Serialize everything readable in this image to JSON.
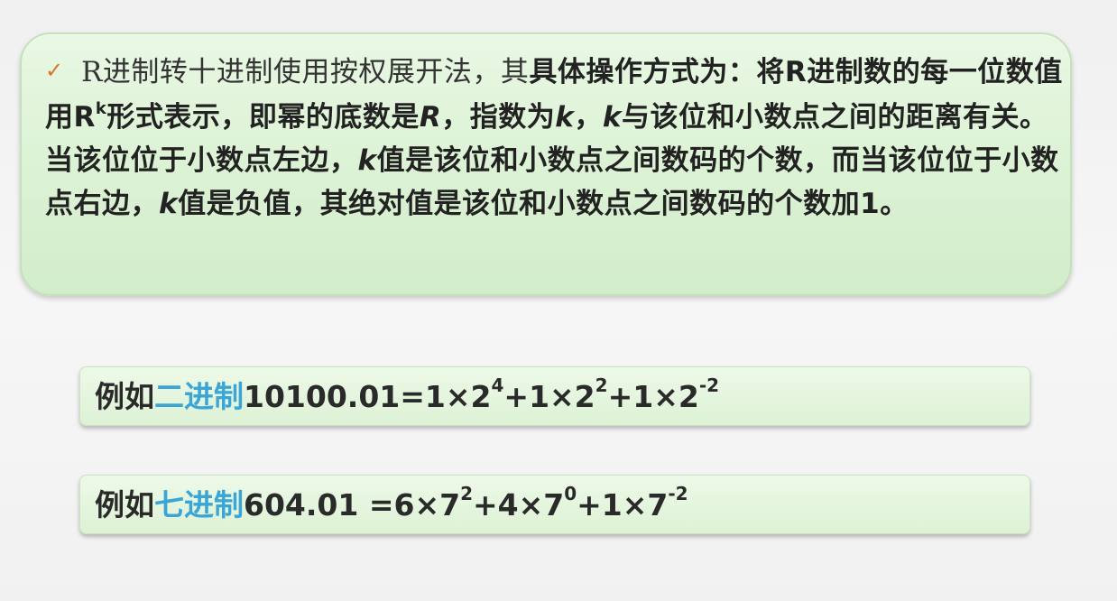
{
  "main": {
    "check_icon": "✓",
    "lead_normal": "R进制转十进制使用按权展开法，其",
    "seg1": "具体操作方式为：将R进制数的每一位数值用R",
    "sup_k": "k",
    "seg2": "形式表示，即幂的底数是",
    "var_R": "R",
    "seg3": "，指数为",
    "var_k1": "k",
    "seg4": "，",
    "var_k2": "k",
    "seg5": "与该位和小数点之间的距离有关。当该位位于小数点左边，",
    "var_k3": "k",
    "seg6": "值是该位和小数点之间数码的个数，而当该位位于小数点右边，",
    "var_k4": "k",
    "seg7": "值是负值，其绝对值是该位和小数点之间数码的个数加1。"
  },
  "example1": {
    "prefix": "例如",
    "highlight": "二进制",
    "value": "10100.01=1×2",
    "exp1": "4",
    "mid1": "+1×2",
    "exp2": "2",
    "mid2": "+1×2",
    "exp3": "-2"
  },
  "example2": {
    "prefix": "例如",
    "highlight": "七进制",
    "value": "604.01 =6×7",
    "exp1": "2",
    "mid1": "+4×7",
    "exp2": "0",
    "mid2": "+1×7",
    "exp3": "-2"
  },
  "colors": {
    "highlight": "#3aa5d6",
    "check": "#d9752a",
    "box_green": "#ddf3d6"
  }
}
